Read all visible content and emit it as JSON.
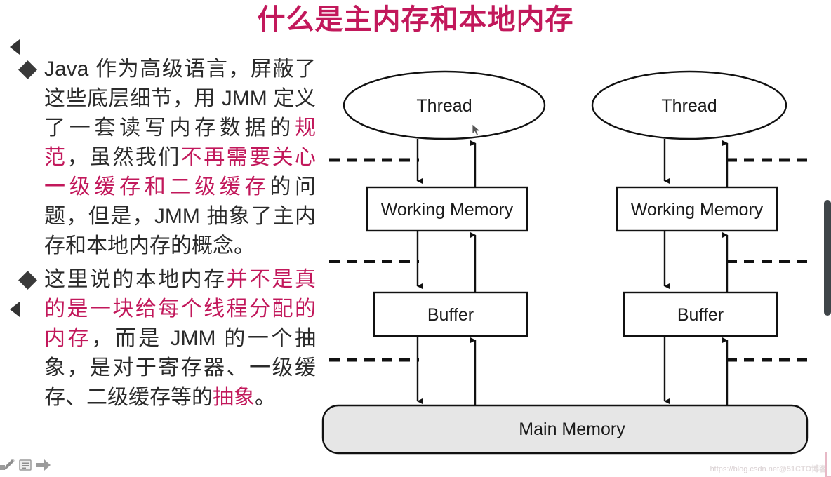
{
  "title": "什么是主内存和本地内存",
  "colors": {
    "title": "#c2185b",
    "highlight": "#c2185b",
    "body_text": "#2b2b2b",
    "box_fill": "#ffffff",
    "main_memory_fill": "#e6e6e6",
    "scrollbar": "#3f4549"
  },
  "bullets": [
    {
      "marker": "diamond",
      "segments": [
        {
          "text": "Java 作为高级语言，屏蔽了这些底层细节，用 JMM 定义了一套读写内存数据的",
          "highlight": false
        },
        {
          "text": "规范",
          "highlight": true
        },
        {
          "text": "，虽然我们",
          "highlight": false
        },
        {
          "text": "不再需要关心一级缓存和二级缓存",
          "highlight": true
        },
        {
          "text": "的问题，但是，JMM 抽象了主内存和本地内存的概念。",
          "highlight": false
        }
      ]
    },
    {
      "marker": "diamond",
      "segments": [
        {
          "text": "这里说的本地内存",
          "highlight": false
        },
        {
          "text": "并不是真的是一块给每个线程分配的内存",
          "highlight": true
        },
        {
          "text": "，而是 JMM 的一个抽象，是对于寄存器、一级缓存、二级缓存等的",
          "highlight": false
        },
        {
          "text": "抽象",
          "highlight": true
        },
        {
          "text": "。",
          "highlight": false
        }
      ]
    }
  ],
  "diagram": {
    "type": "jmm-memory-model",
    "threads": [
      {
        "thread_label": "Thread",
        "working_memory_label": "Working Memory",
        "buffer_label": "Buffer"
      },
      {
        "thread_label": "Thread",
        "working_memory_label": "Working Memory",
        "buffer_label": "Buffer"
      }
    ],
    "main_memory_label": "Main Memory",
    "dashed_separators": 3,
    "arrow_pairs_per_column": 3
  },
  "mini_toolbar": {
    "items": [
      {
        "icon": "pen-icon",
        "label": "Pen"
      },
      {
        "icon": "note-icon",
        "label": "Notes"
      },
      {
        "icon": "arrow-right-icon",
        "label": "Next"
      }
    ]
  },
  "nav": {
    "prev_label": "Previous",
    "next_label": "Next"
  },
  "watermark": {
    "url": "https://blog.csdn.net",
    "account": "@51CTO博客"
  }
}
